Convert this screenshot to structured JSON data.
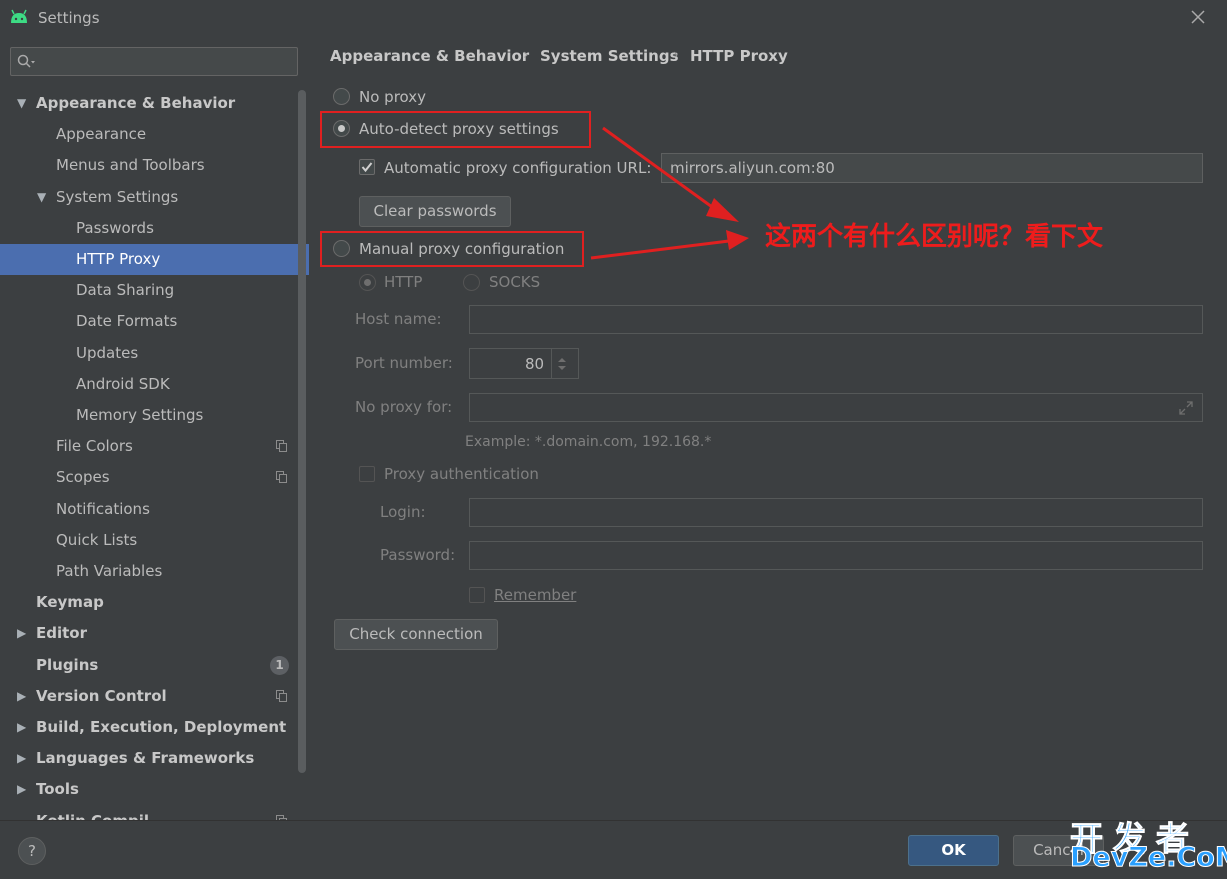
{
  "window": {
    "title": "Settings"
  },
  "sidebar": {
    "search_placeholder": "",
    "items": [
      {
        "label": "Appearance & Behavior",
        "level": 0,
        "bold": true,
        "arrow": "down"
      },
      {
        "label": "Appearance",
        "level": 1
      },
      {
        "label": "Menus and Toolbars",
        "level": 1
      },
      {
        "label": "System Settings",
        "level": 1,
        "arrow": "down"
      },
      {
        "label": "Passwords",
        "level": 2
      },
      {
        "label": "HTTP Proxy",
        "level": 2,
        "selected": true
      },
      {
        "label": "Data Sharing",
        "level": 2
      },
      {
        "label": "Date Formats",
        "level": 2
      },
      {
        "label": "Updates",
        "level": 2
      },
      {
        "label": "Android SDK",
        "level": 2
      },
      {
        "label": "Memory Settings",
        "level": 2
      },
      {
        "label": "File Colors",
        "level": 1,
        "copy": true
      },
      {
        "label": "Scopes",
        "level": 1,
        "copy": true
      },
      {
        "label": "Notifications",
        "level": 1
      },
      {
        "label": "Quick Lists",
        "level": 1
      },
      {
        "label": "Path Variables",
        "level": 1
      },
      {
        "label": "Keymap",
        "level": 0,
        "bold": true
      },
      {
        "label": "Editor",
        "level": 0,
        "bold": true,
        "arrow": "right"
      },
      {
        "label": "Plugins",
        "level": 0,
        "bold": true,
        "count": "1"
      },
      {
        "label": "Version Control",
        "level": 0,
        "bold": true,
        "arrow": "right",
        "copy": true
      },
      {
        "label": "Build, Execution, Deployment",
        "level": 0,
        "bold": true,
        "arrow": "right"
      },
      {
        "label": "Languages & Frameworks",
        "level": 0,
        "bold": true,
        "arrow": "right"
      },
      {
        "label": "Tools",
        "level": 0,
        "bold": true,
        "arrow": "right"
      },
      {
        "label": "Kotlin Compil...",
        "level": 0,
        "bold": true,
        "copy": true
      }
    ]
  },
  "breadcrumb": [
    "Appearance & Behavior",
    "System Settings",
    "HTTP Proxy"
  ],
  "breadcrumb_sep": "›",
  "proxy": {
    "no_proxy_label": "No proxy",
    "auto_detect_label": "Auto-detect proxy settings",
    "auto_config_url_label": "Automatic proxy configuration URL:",
    "auto_config_url_value": "mirrors.aliyun.com:80",
    "clear_passwords_label": "Clear passwords",
    "manual_label": "Manual proxy configuration",
    "http_label": "HTTP",
    "socks_label": "SOCKS",
    "host_label": "Host name:",
    "host_value": "",
    "port_label": "Port number:",
    "port_value": "80",
    "no_proxy_for_label": "No proxy for:",
    "no_proxy_for_value": "",
    "example_text": "Example: *.domain.com, 192.168.*",
    "auth_label": "Proxy authentication",
    "login_label": "Login:",
    "login_value": "",
    "password_label": "Password:",
    "password_value": "",
    "remember_label": "Remember",
    "check_connection_label": "Check connection",
    "selected_mode": "auto-detect",
    "auto_config_url_checked": true
  },
  "annotation": {
    "text": "这两个有什么区别呢？看下文",
    "color": "#ee1c1c"
  },
  "footer": {
    "help": "?",
    "ok": "OK",
    "cancel": "Cancel"
  },
  "watermark": {
    "line1": "开发者",
    "line2": "DevZe.CoM"
  },
  "colors": {
    "accent": "#4b6eaf",
    "ok_button": "#365880",
    "background": "#3c3f41",
    "annotation": "#e02020"
  }
}
